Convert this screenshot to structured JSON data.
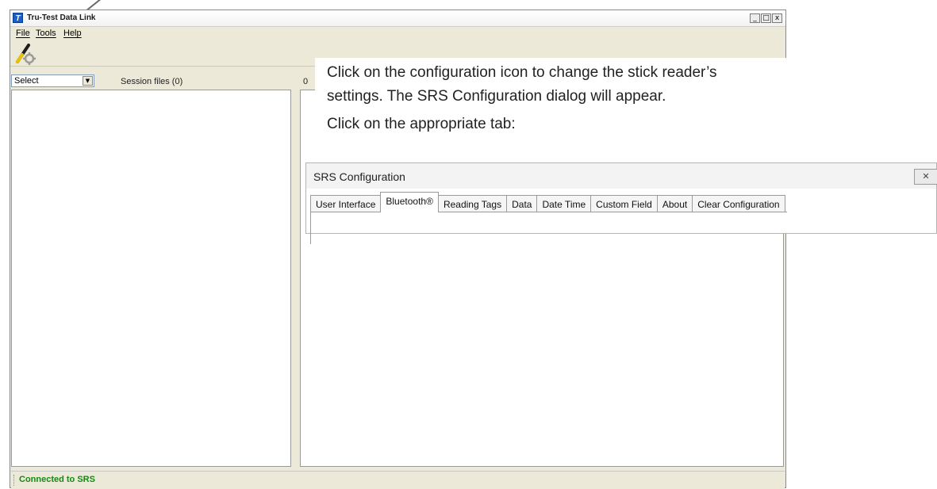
{
  "window": {
    "title": "Tru-Test Data Link",
    "app_icon_glyph": "T",
    "buttons": [
      "_",
      "□",
      "x"
    ]
  },
  "menu": {
    "file": "File",
    "tools": "Tools",
    "help": "Help"
  },
  "toolbar": {
    "config_icon": "configuration-stick-gear-icon"
  },
  "left_panel": {
    "select_value": "Select",
    "session_files_label": "Session files (0)"
  },
  "right_panel": {
    "counter_text": "0"
  },
  "status": {
    "text": "Connected to SRS",
    "color": "#138a13"
  },
  "callout": {
    "line1": "Click on the configuration icon to change the stick reader’s",
    "line2": "settings. The SRS Configuration dialog will appear.",
    "line3": "Click on the appropriate tab:"
  },
  "dialog": {
    "title": "SRS Configuration",
    "close_glyph": "✕",
    "tabs": [
      {
        "label": "User Interface"
      },
      {
        "label": "Bluetooth®"
      },
      {
        "label": "Reading Tags"
      },
      {
        "label": "Data"
      },
      {
        "label": "Date Time"
      },
      {
        "label": "Custom Field"
      },
      {
        "label": "About"
      },
      {
        "label": "Clear Configuration"
      }
    ],
    "active_tab": "Bluetooth®"
  }
}
